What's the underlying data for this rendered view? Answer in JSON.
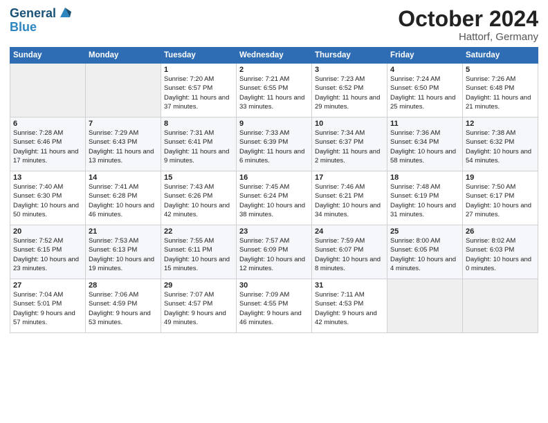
{
  "header": {
    "logo_line1": "General",
    "logo_line2": "Blue",
    "month": "October 2024",
    "location": "Hattorf, Germany"
  },
  "columns": [
    "Sunday",
    "Monday",
    "Tuesday",
    "Wednesday",
    "Thursday",
    "Friday",
    "Saturday"
  ],
  "weeks": [
    [
      {
        "day": "",
        "empty": true
      },
      {
        "day": "",
        "empty": true
      },
      {
        "day": "1",
        "sunrise": "7:20 AM",
        "sunset": "6:57 PM",
        "daylight": "Daylight: 11 hours and 37 minutes."
      },
      {
        "day": "2",
        "sunrise": "7:21 AM",
        "sunset": "6:55 PM",
        "daylight": "Daylight: 11 hours and 33 minutes."
      },
      {
        "day": "3",
        "sunrise": "7:23 AM",
        "sunset": "6:52 PM",
        "daylight": "Daylight: 11 hours and 29 minutes."
      },
      {
        "day": "4",
        "sunrise": "7:24 AM",
        "sunset": "6:50 PM",
        "daylight": "Daylight: 11 hours and 25 minutes."
      },
      {
        "day": "5",
        "sunrise": "7:26 AM",
        "sunset": "6:48 PM",
        "daylight": "Daylight: 11 hours and 21 minutes."
      }
    ],
    [
      {
        "day": "6",
        "sunrise": "7:28 AM",
        "sunset": "6:46 PM",
        "daylight": "Daylight: 11 hours and 17 minutes."
      },
      {
        "day": "7",
        "sunrise": "7:29 AM",
        "sunset": "6:43 PM",
        "daylight": "Daylight: 11 hours and 13 minutes."
      },
      {
        "day": "8",
        "sunrise": "7:31 AM",
        "sunset": "6:41 PM",
        "daylight": "Daylight: 11 hours and 9 minutes."
      },
      {
        "day": "9",
        "sunrise": "7:33 AM",
        "sunset": "6:39 PM",
        "daylight": "Daylight: 11 hours and 6 minutes."
      },
      {
        "day": "10",
        "sunrise": "7:34 AM",
        "sunset": "6:37 PM",
        "daylight": "Daylight: 11 hours and 2 minutes."
      },
      {
        "day": "11",
        "sunrise": "7:36 AM",
        "sunset": "6:34 PM",
        "daylight": "Daylight: 10 hours and 58 minutes."
      },
      {
        "day": "12",
        "sunrise": "7:38 AM",
        "sunset": "6:32 PM",
        "daylight": "Daylight: 10 hours and 54 minutes."
      }
    ],
    [
      {
        "day": "13",
        "sunrise": "7:40 AM",
        "sunset": "6:30 PM",
        "daylight": "Daylight: 10 hours and 50 minutes."
      },
      {
        "day": "14",
        "sunrise": "7:41 AM",
        "sunset": "6:28 PM",
        "daylight": "Daylight: 10 hours and 46 minutes."
      },
      {
        "day": "15",
        "sunrise": "7:43 AM",
        "sunset": "6:26 PM",
        "daylight": "Daylight: 10 hours and 42 minutes."
      },
      {
        "day": "16",
        "sunrise": "7:45 AM",
        "sunset": "6:24 PM",
        "daylight": "Daylight: 10 hours and 38 minutes."
      },
      {
        "day": "17",
        "sunrise": "7:46 AM",
        "sunset": "6:21 PM",
        "daylight": "Daylight: 10 hours and 34 minutes."
      },
      {
        "day": "18",
        "sunrise": "7:48 AM",
        "sunset": "6:19 PM",
        "daylight": "Daylight: 10 hours and 31 minutes."
      },
      {
        "day": "19",
        "sunrise": "7:50 AM",
        "sunset": "6:17 PM",
        "daylight": "Daylight: 10 hours and 27 minutes."
      }
    ],
    [
      {
        "day": "20",
        "sunrise": "7:52 AM",
        "sunset": "6:15 PM",
        "daylight": "Daylight: 10 hours and 23 minutes."
      },
      {
        "day": "21",
        "sunrise": "7:53 AM",
        "sunset": "6:13 PM",
        "daylight": "Daylight: 10 hours and 19 minutes."
      },
      {
        "day": "22",
        "sunrise": "7:55 AM",
        "sunset": "6:11 PM",
        "daylight": "Daylight: 10 hours and 15 minutes."
      },
      {
        "day": "23",
        "sunrise": "7:57 AM",
        "sunset": "6:09 PM",
        "daylight": "Daylight: 10 hours and 12 minutes."
      },
      {
        "day": "24",
        "sunrise": "7:59 AM",
        "sunset": "6:07 PM",
        "daylight": "Daylight: 10 hours and 8 minutes."
      },
      {
        "day": "25",
        "sunrise": "8:00 AM",
        "sunset": "6:05 PM",
        "daylight": "Daylight: 10 hours and 4 minutes."
      },
      {
        "day": "26",
        "sunrise": "8:02 AM",
        "sunset": "6:03 PM",
        "daylight": "Daylight: 10 hours and 0 minutes."
      }
    ],
    [
      {
        "day": "27",
        "sunrise": "7:04 AM",
        "sunset": "5:01 PM",
        "daylight": "Daylight: 9 hours and 57 minutes."
      },
      {
        "day": "28",
        "sunrise": "7:06 AM",
        "sunset": "4:59 PM",
        "daylight": "Daylight: 9 hours and 53 minutes."
      },
      {
        "day": "29",
        "sunrise": "7:07 AM",
        "sunset": "4:57 PM",
        "daylight": "Daylight: 9 hours and 49 minutes."
      },
      {
        "day": "30",
        "sunrise": "7:09 AM",
        "sunset": "4:55 PM",
        "daylight": "Daylight: 9 hours and 46 minutes."
      },
      {
        "day": "31",
        "sunrise": "7:11 AM",
        "sunset": "4:53 PM",
        "daylight": "Daylight: 9 hours and 42 minutes."
      },
      {
        "day": "",
        "empty": true
      },
      {
        "day": "",
        "empty": true
      }
    ]
  ]
}
